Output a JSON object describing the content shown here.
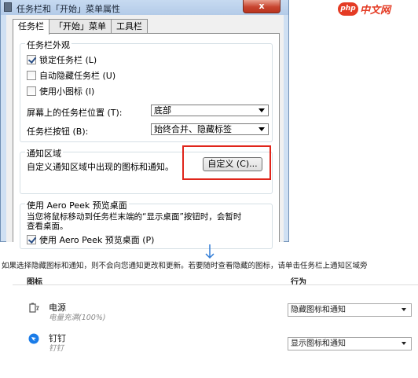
{
  "window": {
    "title": "任务栏和「开始」菜单属性",
    "close_label": "x"
  },
  "tabs": [
    {
      "label": "任务栏",
      "active": true
    },
    {
      "label": "「开始」菜单",
      "active": false
    },
    {
      "label": "工具栏",
      "active": false
    }
  ],
  "appearance": {
    "legend": "任务栏外观",
    "lock_taskbar": {
      "label": "锁定任务栏 (L)",
      "checked": true
    },
    "auto_hide": {
      "label": "自动隐藏任务栏 (U)",
      "checked": false
    },
    "small_icons": {
      "label": "使用小图标 (I)",
      "checked": false
    },
    "location_label": "屏幕上的任务栏位置 (T):",
    "location_value": "底部",
    "buttons_label": "任务栏按钮 (B):",
    "buttons_value": "始终合并、隐藏标签"
  },
  "notification": {
    "legend": "通知区域",
    "description": "自定义通知区域中出现的图标和通知。",
    "customize_label": "自定义 (C)..."
  },
  "peek": {
    "legend": "使用 Aero Peek 预览桌面",
    "description_line1": "当您将鼠标移动到任务栏末端的“显示桌面”按钮时，会暂时",
    "description_line2": "查看桌面。",
    "checkbox": {
      "label": "使用 Aero Peek 预览桌面 (P)",
      "checked": true
    }
  },
  "watermark": {
    "badge": "php",
    "text": "中文网"
  },
  "lower": {
    "instruction": "如果选择隐藏图标和通知，则不会向您通知更改和更新。若要随时查看隐藏的图标，请单击任务栏上通知区域旁",
    "col_icon": "图标",
    "col_behavior": "行为",
    "rows": [
      {
        "name": "电源",
        "sub": "电量充满(100%)",
        "behavior": "隐藏图标和通知",
        "icon": "power-icon"
      },
      {
        "name": "钉钉",
        "sub": "钉钉",
        "behavior": "显示图标和通知",
        "icon": "dingtalk-icon"
      }
    ]
  },
  "colors": {
    "highlight": "#e0251b",
    "watermark": "#e43b24",
    "arrow": "#2f7bd6"
  }
}
